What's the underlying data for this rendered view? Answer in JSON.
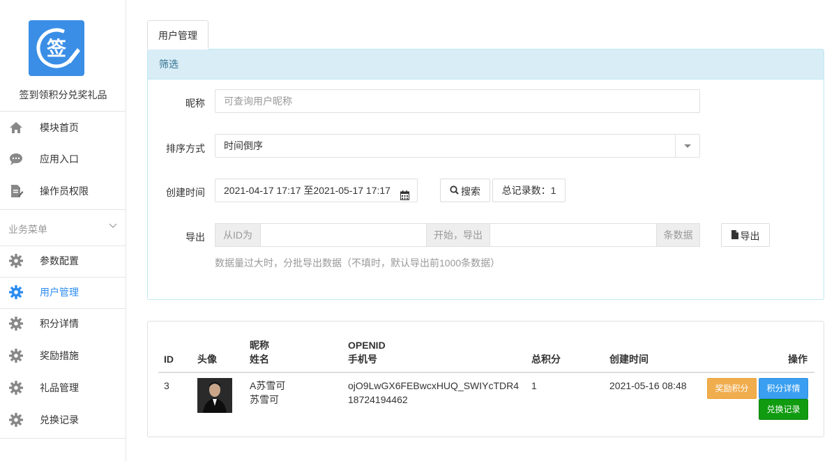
{
  "sidebar": {
    "app_name": "签到领积分兑奖礼品",
    "top_items": [
      {
        "label": "模块首页",
        "icon": "home-icon"
      },
      {
        "label": "应用入口",
        "icon": "chat-bubble-icon"
      },
      {
        "label": "操作员权限",
        "icon": "document-edit-icon"
      }
    ],
    "section_label": "业务菜单",
    "section_items": [
      {
        "label": "参数配置",
        "icon": "gear-icon"
      },
      {
        "label": "用户管理",
        "icon": "gear-icon",
        "active": true
      },
      {
        "label": "积分详情",
        "icon": "gear-icon"
      },
      {
        "label": "奖励措施",
        "icon": "gear-icon"
      },
      {
        "label": "礼品管理",
        "icon": "gear-icon"
      },
      {
        "label": "兑换记录",
        "icon": "gear-icon"
      }
    ],
    "active_color": "#2d8cf0"
  },
  "tab": {
    "label": "用户管理"
  },
  "filter": {
    "title": "筛选",
    "nickname": {
      "label": "昵称",
      "placeholder": "可查询用户昵称",
      "value": ""
    },
    "sort": {
      "label": "排序方式",
      "value": "时间倒序"
    },
    "created": {
      "label": "创建时间",
      "value": "2021-04-17 17:17 至2021-05-17 17:17"
    },
    "search_button": "搜索",
    "total_records": "总记录数：1",
    "export": {
      "label": "导出",
      "from_addon": "从ID为",
      "start_addon": "开始，导出",
      "count_addon": "条数据",
      "button": "导出",
      "hint": "数据量过大时，分批导出数据（不填时，默认导出前1000条数据）"
    }
  },
  "table": {
    "headers": {
      "id": "ID",
      "avatar": "头像",
      "nickname": "昵称",
      "name": "姓名",
      "openid": "OPENID",
      "phone": "手机号",
      "points": "总积分",
      "created": "创建时间",
      "actions": "操作"
    },
    "rows": [
      {
        "id": "3",
        "nickname": "A苏雪可",
        "name": "苏雪可",
        "openid": "ojO9LwGX6FEBwcxHUQ_SWIYcTDR4",
        "phone": "18724194462",
        "points": "1",
        "created": "2021-05-16 08:48",
        "actions": {
          "reward": "奖励积分",
          "detail": "积分详情",
          "exchange": "兑换记录"
        }
      }
    ]
  },
  "colors": {
    "warning": "#f0ad4e",
    "info": "#3a9ff0",
    "success": "#109b10",
    "panel_head_bg": "#d9edf7"
  }
}
